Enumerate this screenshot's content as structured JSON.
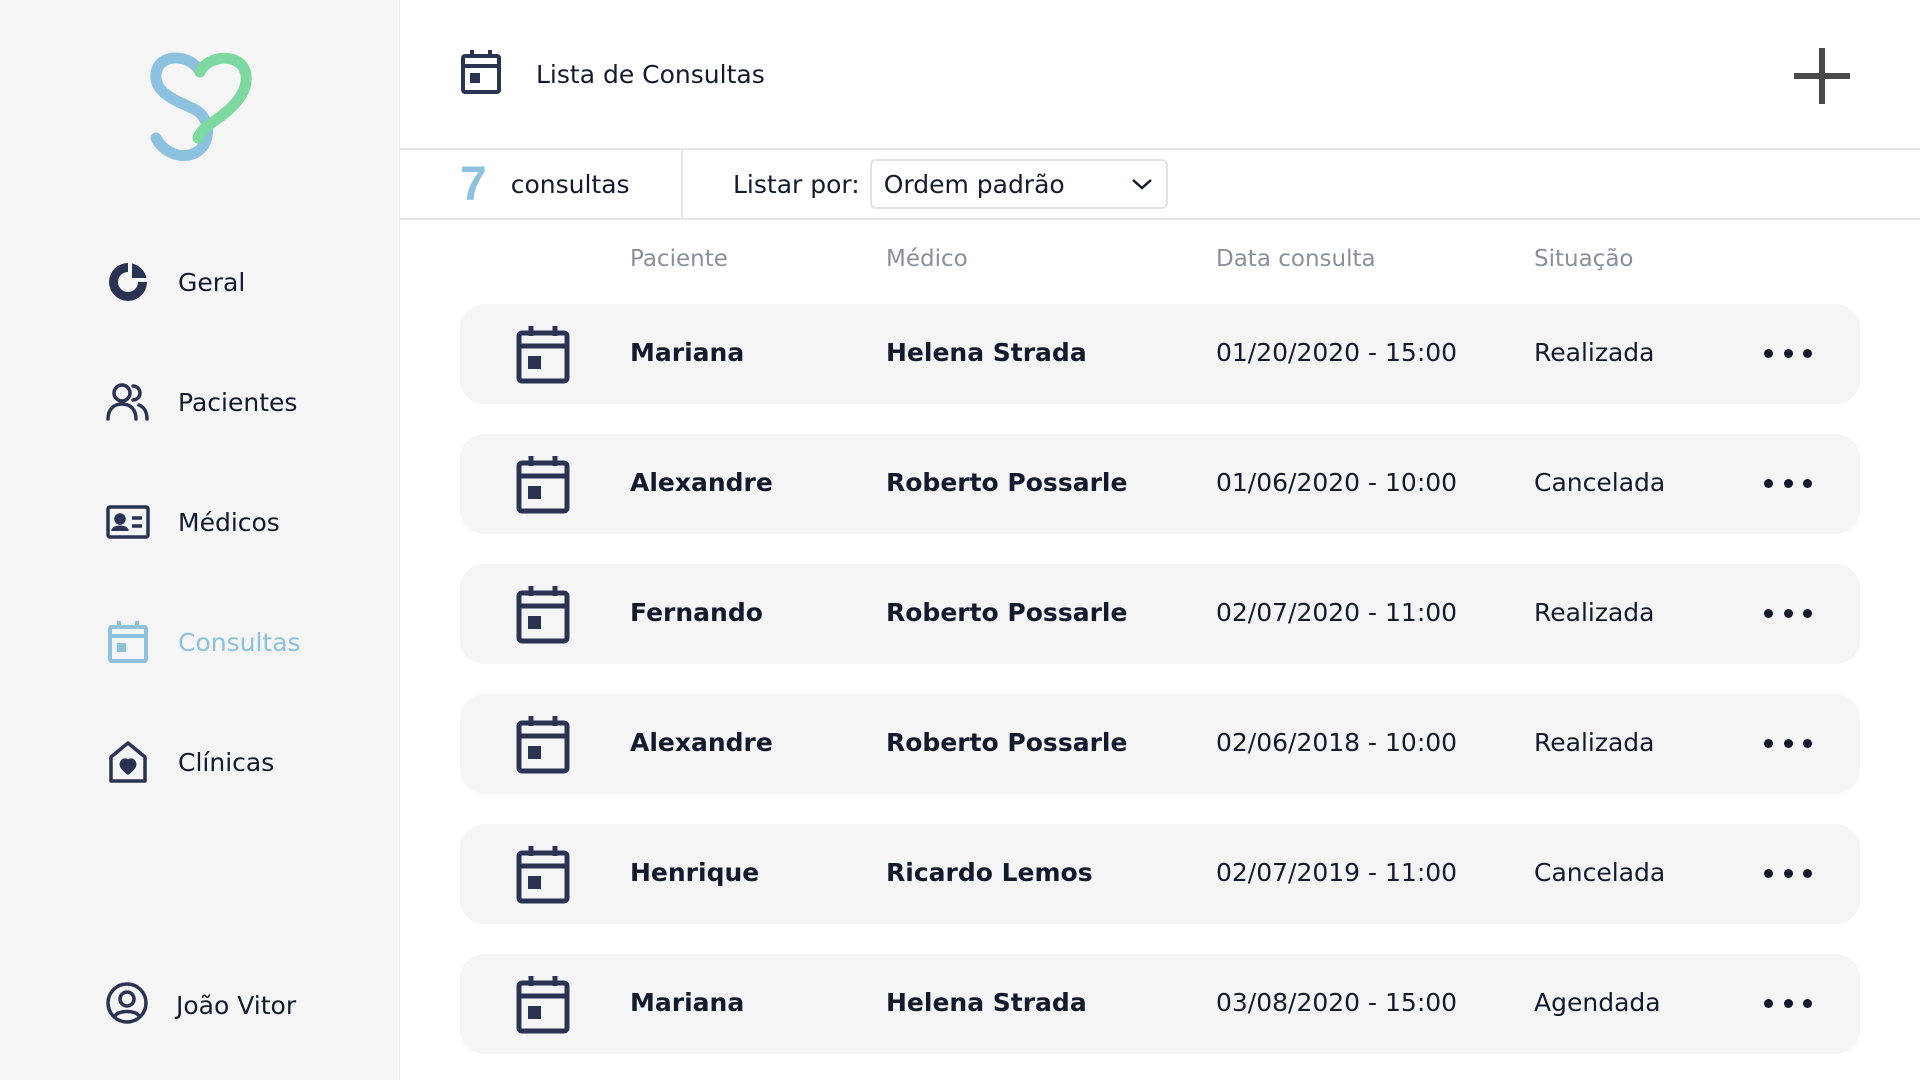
{
  "header": {
    "title": "Lista de Consultas"
  },
  "sidebar": {
    "items": [
      {
        "label": "Geral",
        "icon": "pie-chart-icon"
      },
      {
        "label": "Pacientes",
        "icon": "users-icon"
      },
      {
        "label": "Médicos",
        "icon": "id-card-icon"
      },
      {
        "label": "Consultas",
        "icon": "calendar-icon",
        "active": true
      },
      {
        "label": "Clínicas",
        "icon": "clinic-house-icon"
      }
    ],
    "user": {
      "name": "João Vitor",
      "icon": "user-circle-icon"
    }
  },
  "summary": {
    "count": "7",
    "count_label": "consultas"
  },
  "sort": {
    "label": "Listar por:",
    "selected": "Ordem padrão"
  },
  "table": {
    "columns": [
      "Paciente",
      "Médico",
      "Data consulta",
      "Situação"
    ],
    "rows": [
      {
        "paciente": "Mariana",
        "medico": "Helena Strada",
        "data": "01/20/2020 - 15:00",
        "situacao": "Realizada"
      },
      {
        "paciente": "Alexandre",
        "medico": "Roberto Possarle",
        "data": "01/06/2020 - 10:00",
        "situacao": "Cancelada"
      },
      {
        "paciente": "Fernando",
        "medico": "Roberto Possarle",
        "data": "02/07/2020 - 11:00",
        "situacao": "Realizada"
      },
      {
        "paciente": "Alexandre",
        "medico": "Roberto Possarle",
        "data": "02/06/2018 - 10:00",
        "situacao": "Realizada"
      },
      {
        "paciente": "Henrique",
        "medico": "Ricardo Lemos",
        "data": "02/07/2019 - 11:00",
        "situacao": "Cancelada"
      },
      {
        "paciente": "Mariana",
        "medico": "Helena Strada",
        "data": "03/08/2020 - 15:00",
        "situacao": "Agendada"
      }
    ]
  },
  "colors": {
    "accent": "#8cc1df",
    "logo_green": "#7ed9a0",
    "text": "#141a2e",
    "row_bg": "#f5f5f5"
  }
}
